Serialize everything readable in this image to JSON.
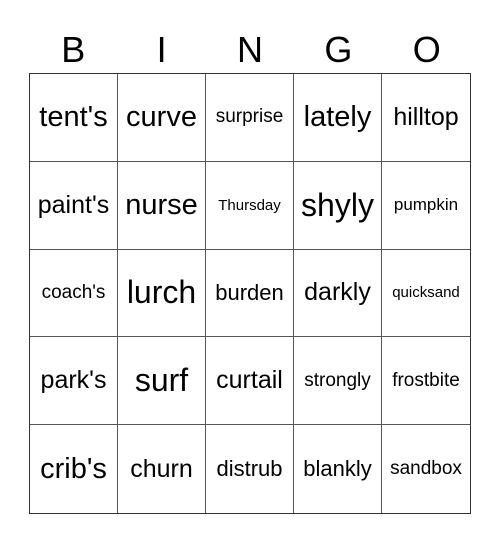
{
  "header": {
    "letters": [
      "B",
      "I",
      "N",
      "G",
      "O"
    ]
  },
  "board": {
    "rows": [
      [
        "tent's",
        "curve",
        "surprise",
        "lately",
        "hilltop"
      ],
      [
        "paint's",
        "nurse",
        "Thursday",
        "shyly",
        "pumpkin"
      ],
      [
        "coach's",
        "lurch",
        "burden",
        "darkly",
        "quicksand"
      ],
      [
        "park's",
        "surf",
        "curtail",
        "strongly",
        "frostbite"
      ],
      [
        "crib's",
        "churn",
        "distrub",
        "blankly",
        "sandbox"
      ]
    ]
  }
}
